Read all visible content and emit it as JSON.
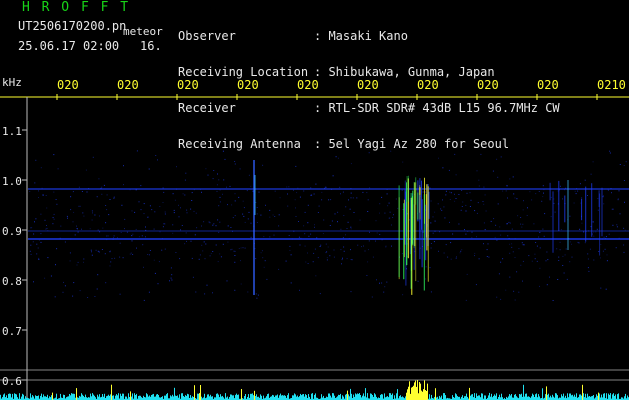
{
  "header": {
    "logo": "H R O F F T",
    "file_name": "UT2506170200.pn",
    "file_suffix": "meteor",
    "datetime": "25.06.17 02:00",
    "count": "16."
  },
  "info": {
    "labels": [
      "Observer",
      "Receiving Location",
      "Receiver",
      "Receiving Antenna"
    ],
    "values": [
      ": Masaki Kano",
      ": Shibukawa, Gunma, Japan",
      ": RTL-SDR SDR# 43dB L15 96.7MHz CW",
      ": 5el Yagi Az 280 for Seoul"
    ]
  },
  "time_ruler": {
    "labels": [
      "020",
      "020",
      "020",
      "020",
      "020",
      "020",
      "020",
      "020",
      "020",
      "0210"
    ]
  },
  "y_axis": {
    "unit": "kHz",
    "labels": [
      "1.1",
      "1.0",
      "0.9",
      "0.8",
      "0.7",
      "0.6"
    ]
  },
  "colors": {
    "background": "#000000",
    "signal_blue": "#2040ff",
    "meteor_yellow": "#ffff30",
    "meteor_green": "#30ff60",
    "noise_cyan": "#20e0f0",
    "text_white": "#e8e8e8",
    "logo_green": "#18d418"
  }
}
